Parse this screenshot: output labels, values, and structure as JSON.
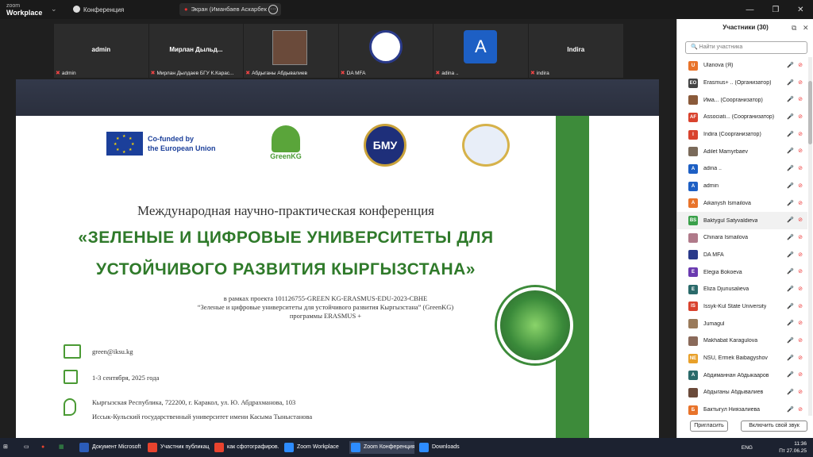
{
  "titlebar": {
    "logo_small": "zoom",
    "logo_big": "Workplace",
    "conference": "Конференция",
    "share_label": "Экран (Иманбаев Аскарбек"
  },
  "gallery": [
    {
      "name": "admin",
      "label": "admin"
    },
    {
      "name": "Мирлан  Дыльд...",
      "label": "Мирлан Дылдаев БГУ К.Карас..."
    },
    {
      "name": "",
      "label": "Абдыганы Абдывалиев"
    },
    {
      "name": "",
      "label": "DA MFA"
    },
    {
      "name": "",
      "label": "adina ..",
      "avatar": "A"
    },
    {
      "name": "Indira",
      "label": "indira"
    }
  ],
  "slide": {
    "eu_text_1": "Co-funded by",
    "eu_text_2": "the European Union",
    "greenkg": "GreenKG",
    "blogo_text": "БМУ",
    "conf_title": "Международная научно-практическая конференция",
    "main_title_1": "«ЗЕЛЕНЫЕ И ЦИФРОВЫЕ УНИВЕРСИТЕТЫ ДЛЯ",
    "main_title_2": "УСТОЙЧИВОГО РАЗВИТИЯ КЫРГЫЗСТАНА»",
    "proj_1": "в рамках проекта 101126755-GREEN KG-ERASMUS-EDU-2023-CBHE",
    "proj_2": "“Зеленые и цифровые университеты для устойчивого развития Кыргызстана” (GreenKG)",
    "proj_3": "программы ERASMUS +",
    "email": "green@iksu.kg",
    "date": "1-3 сентября, 2025 года",
    "address_1": "Кыргызская Республика,  722200,  г. Каракол, ул. Ю. Абдрахманова, 103",
    "address_2": "Иссык-Кульский государственный университет имени Касыма Тыныстанова"
  },
  "participants": {
    "title": "Участники (30)",
    "search_placeholder": "Найти участника",
    "rows": [
      {
        "initials": "U",
        "color": "#e8732a",
        "name": "Ulanova (Я)"
      },
      {
        "initials": "EO",
        "color": "#444",
        "name": "Erasmus+ ..  (Организатор)"
      },
      {
        "initials": "",
        "color": "#8a5a3a",
        "name": "Има...  (Соорганизатор)"
      },
      {
        "initials": "AF",
        "color": "#d9432e",
        "name": "Associati... (Соорганизатор)"
      },
      {
        "initials": "I",
        "color": "#d9432e",
        "name": "Indira (Соорганизатор)"
      },
      {
        "initials": "",
        "color": "#7a6a5a",
        "name": "Adilet Mamyrbaev"
      },
      {
        "initials": "A",
        "color": "#1d5fc4",
        "name": "adina .."
      },
      {
        "initials": "A",
        "color": "#1d5fc4",
        "name": "admin"
      },
      {
        "initials": "A",
        "color": "#e8732a",
        "name": "Aikanysh Ismailova"
      },
      {
        "initials": "BS",
        "color": "#3aa04a",
        "name": "Baktygul Satyvaldieva"
      },
      {
        "initials": "",
        "color": "#b07a8a",
        "name": "Chinara Ismailova"
      },
      {
        "initials": "",
        "color": "#2a3a8a",
        "name": "DA MFA"
      },
      {
        "initials": "E",
        "color": "#6a3ab0",
        "name": "Elegia Bokoeva"
      },
      {
        "initials": "E",
        "color": "#2a6a6a",
        "name": "Eliza Djunusalieva"
      },
      {
        "initials": "IS",
        "color": "#d9432e",
        "name": "Issyk-Kul State University"
      },
      {
        "initials": "",
        "color": "#9a7a5a",
        "name": "Jumagul"
      },
      {
        "initials": "",
        "color": "#8a6a5a",
        "name": "Makhabat Karagulova"
      },
      {
        "initials": "NE",
        "color": "#e8a02a",
        "name": "NSU, Ermek Baibagyshov"
      },
      {
        "initials": "A",
        "color": "#2a6a6a",
        "name": "Абдиманнан Абдыкааров"
      },
      {
        "initials": "",
        "color": "#6a4a3a",
        "name": "Абдыганы Абдывалиев"
      },
      {
        "initials": "Б",
        "color": "#e8732a",
        "name": "Бактыгул Ниязалиева"
      }
    ],
    "invite": "Пригласить",
    "unmute": "Включить свой звук"
  },
  "taskbar": {
    "items": [
      {
        "label": "Документ Microsoft ...",
        "color": "#2b5cb8"
      },
      {
        "label": "Участник публикац...",
        "color": "#e8432e"
      },
      {
        "label": "как сфотографиров...",
        "color": "#e8432e"
      },
      {
        "label": "Zoom Workplace",
        "color": "#2d8cff"
      },
      {
        "label": "Zoom Конференция",
        "color": "#2d8cff"
      },
      {
        "label": "Downloads",
        "color": "#2d8cff"
      }
    ],
    "lang": "ENG",
    "time": "11:36",
    "date": "Пт 27.06.25"
  }
}
